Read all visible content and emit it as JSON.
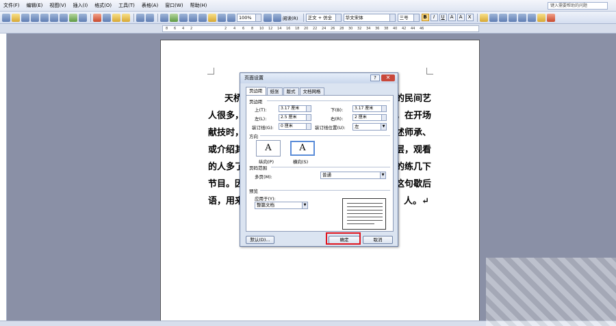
{
  "menubar": {
    "items": [
      "文件(F)",
      "编辑(E)",
      "视图(V)",
      "插入(I)",
      "格式(O)",
      "工具(T)",
      "表格(A)",
      "窗口(W)",
      "帮助(H)"
    ],
    "help_placeholder": "键入需要帮助的问题"
  },
  "toolbar": {
    "zoom": "100%",
    "read_label": "阅读(R)",
    "style": "正文 + 仿全",
    "font": "华文宋体",
    "size": "三号",
    "bold": "B",
    "italic": "I",
    "underline": "U",
    "char_a": "A",
    "char_box": "A",
    "char_scale": "X"
  },
  "ruler": {
    "left_marks": [
      "8",
      "6",
      "4",
      "2"
    ],
    "right_marks": [
      "2",
      "4",
      "6",
      "8",
      "10",
      "12",
      "14",
      "16",
      "18",
      "20",
      "22",
      "24",
      "26",
      "28",
      "30",
      "32",
      "34",
      "36",
      "38",
      "40",
      "42",
      "44",
      "46"
    ]
  },
  "document": {
    "left_lines": [
      "天桥",
      "人很多，",
      "献技时，",
      "或介绍其",
      "的人多了",
      "节目。因",
      "语，用来"
    ],
    "right_lines": [
      "的民间艺",
      "，在开场",
      "述师承、",
      "层，观看",
      "的练几下",
      "这句歇后",
      "人。↵"
    ]
  },
  "dialog": {
    "title": "页面设置",
    "help": "?",
    "close": "✕",
    "tabs": [
      "页边距",
      "纸张",
      "版式",
      "文档网格"
    ],
    "margins_heading": "页边距",
    "top_label": "上(T):",
    "top_value": "3.17 厘米",
    "bottom_label": "下(B):",
    "bottom_value": "3.17 厘米",
    "left_label": "左(L):",
    "left_value": "2.5 厘米",
    "right_label": "右(R):",
    "right_value": "2 厘米",
    "gutter_label": "装订线(G):",
    "gutter_value": "0 厘米",
    "gutter_pos_label": "装订线位置(U):",
    "gutter_pos_value": "左",
    "orientation_heading": "方向",
    "portrait_label": "纵向(P)",
    "landscape_label": "横向(S)",
    "orient_glyph": "A",
    "pages_heading": "页码范围",
    "multiple_pages_label": "多页(M):",
    "multiple_pages_value": "普通",
    "preview_heading": "预览",
    "apply_label": "应用于(Y):",
    "apply_value": "整篇文档",
    "default_button": "默认(D)...",
    "ok_button": "确定",
    "cancel_button": "取消"
  }
}
